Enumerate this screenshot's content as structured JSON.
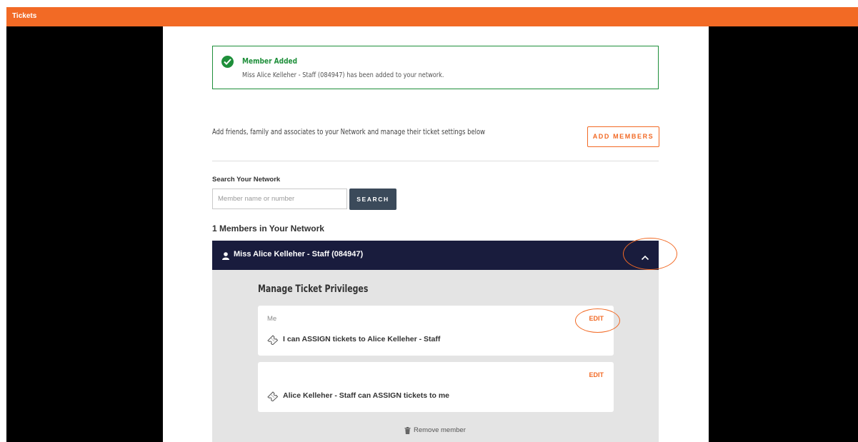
{
  "app": {
    "title": "Tickets"
  },
  "alert": {
    "title": "Member Added",
    "message": "Miss Alice Kelleher - Staff (084947) has been added to your network.",
    "icon": "check-circle-icon",
    "color": "#1e8f3a"
  },
  "intro": {
    "text": "Add friends, family and associates to your Network and manage their ticket settings below",
    "add_button": "ADD MEMBERS"
  },
  "search": {
    "label": "Search Your Network",
    "placeholder": "Member name or number",
    "value": "",
    "button": "SEARCH"
  },
  "network": {
    "count_label": "1 Members in Your Network",
    "members": [
      {
        "name": "Miss Alice Kelleher - Staff (084947)",
        "expanded": true,
        "panel_title": "Manage Ticket Privileges",
        "privileges": [
          {
            "who": "Me",
            "edit": "EDIT",
            "rule": "I can ASSIGN tickets to Alice Kelleher - Staff"
          },
          {
            "who": "",
            "edit": "EDIT",
            "rule": "Alice Kelleher - Staff can ASSIGN tickets to me"
          }
        ],
        "remove": "Remove member"
      }
    ]
  },
  "colors": {
    "accent": "#f26a25",
    "header_navy": "#191c3d",
    "panel_grey": "#e4e4e4",
    "search_button": "#3b4a5a"
  }
}
